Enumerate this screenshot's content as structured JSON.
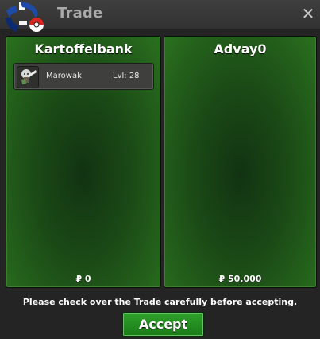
{
  "window": {
    "title": "Trade"
  },
  "trade": {
    "left": {
      "name": "Kartoffelbank",
      "pokemon": [
        {
          "name": "Marowak",
          "level": "Lvl: 28"
        }
      ],
      "money": "₽ 0"
    },
    "right": {
      "name": "Advay0",
      "money": "₽ 50,000"
    }
  },
  "instruction": "Please check over the Trade carefully before accepting.",
  "accept_label": "Accept",
  "icons": {
    "close": "close-icon",
    "logo": "pokeball-logo-icon",
    "pokemon": "marowak-sprite-icon"
  },
  "colors": {
    "panel_green": "#1b4a16",
    "accept_green": "#239d20",
    "titlebar": "#3a3a3a"
  }
}
